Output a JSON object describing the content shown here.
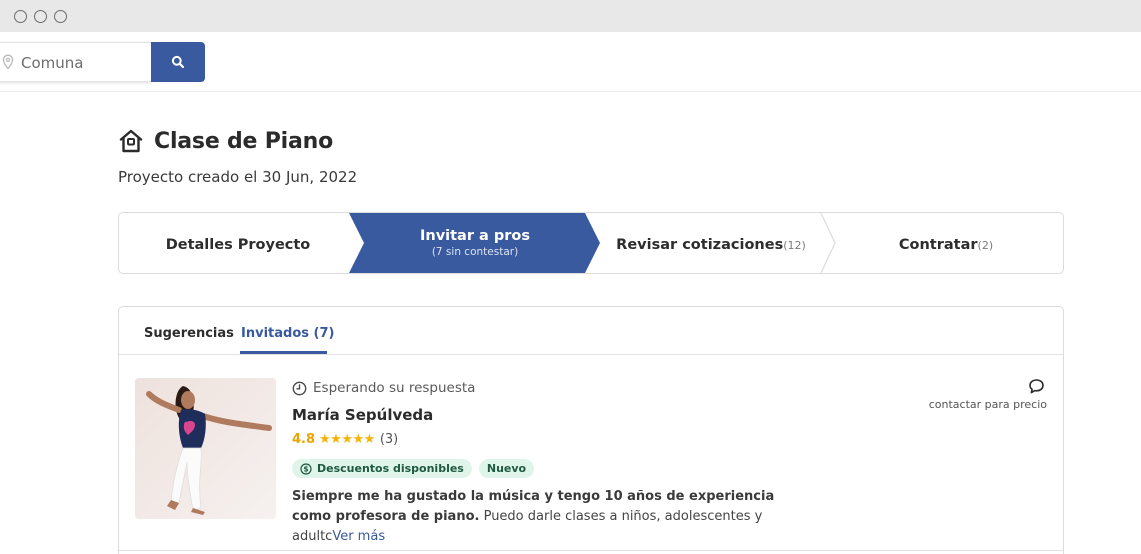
{
  "browser": {
    "controls": [
      "close",
      "minimize",
      "maximize"
    ]
  },
  "search": {
    "placeholder": "Comuna",
    "icons": {
      "location": "location-pin-icon",
      "submit": "search-icon"
    }
  },
  "colors": {
    "accent": "#3a5a9f",
    "star": "#f5b301",
    "badge_bg": "#dff5ea",
    "badge_text": "#1d5a3f"
  },
  "project": {
    "title": "Clase de Piano",
    "icon": "home-icon",
    "created": "Proyecto creado el 30 Jun, 2022"
  },
  "stepper": {
    "active_index": 1,
    "steps": [
      {
        "label": "Detalles Proyecto",
        "count": "",
        "sub": ""
      },
      {
        "label": "Invitar a pros",
        "count": "",
        "sub": "(7 sin contestar)"
      },
      {
        "label": "Revisar cotizaciones",
        "count": "(12)",
        "sub": ""
      },
      {
        "label": "Contratar",
        "count": "(2)",
        "sub": ""
      }
    ]
  },
  "tabs": {
    "items": [
      {
        "label": "Sugerencias",
        "active": false
      },
      {
        "label": "Invitados (7)",
        "active": true
      }
    ]
  },
  "pro": {
    "status": "Esperando su respuesta",
    "name": "María Sepúlveda",
    "rating": "4.8",
    "stars": "★★★★★",
    "reviews": "(3)",
    "badges": [
      "Descuentos disponibles",
      "Nuevo"
    ],
    "desc_bold": "Siempre me ha gustado la música y tengo 10 años de experiencia como profesora de piano.",
    "desc_rest": " Puedo darle clases a niños, adolescentes y adultc",
    "see_more": "Ver más",
    "contact_label": "contactar para precio"
  }
}
